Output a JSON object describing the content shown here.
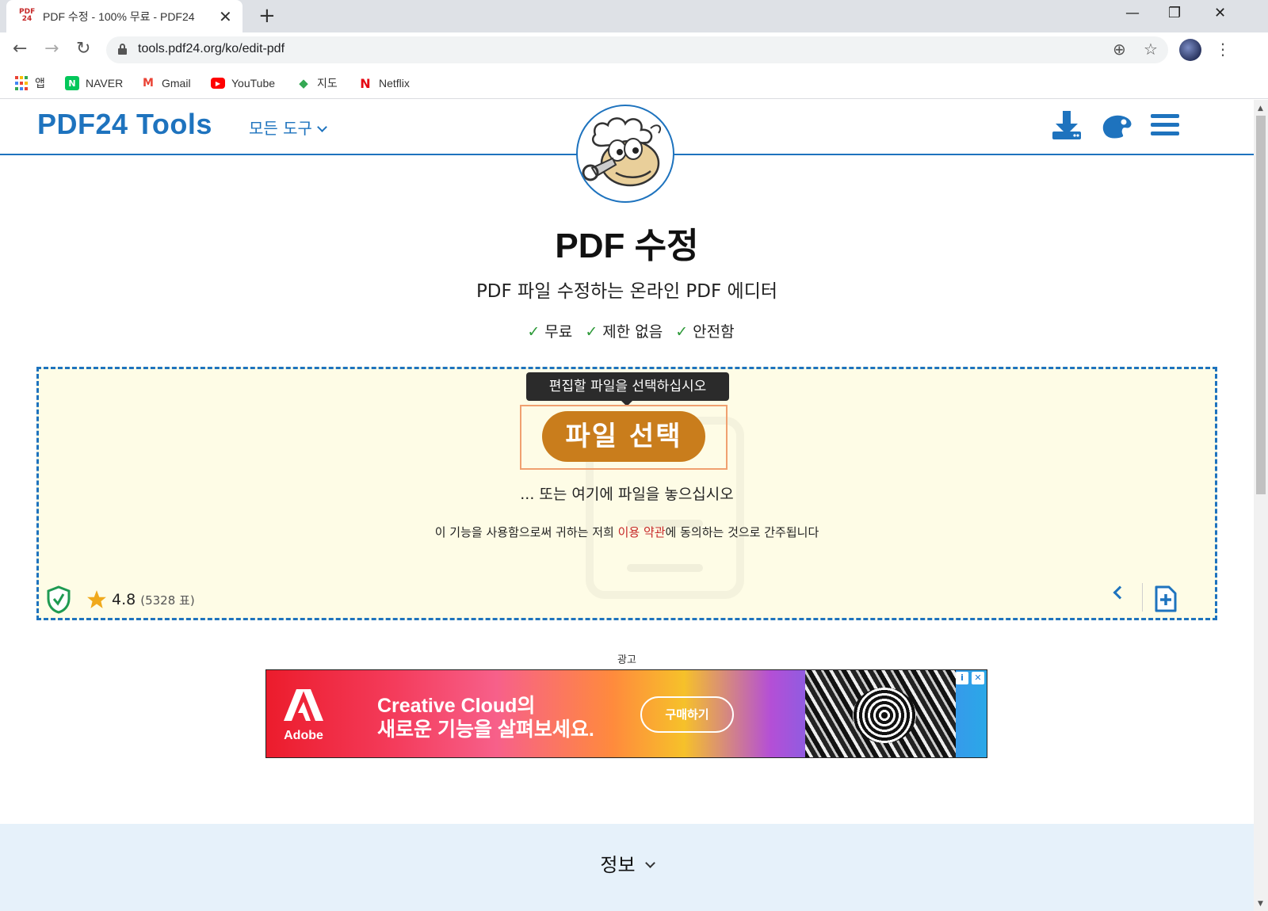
{
  "browser": {
    "tab": {
      "favicon_text_top": "PDF",
      "favicon_text_bottom": "24",
      "title": "PDF 수정 - 100% 무료 - PDF24",
      "close": "✕"
    },
    "new_tab": "+",
    "window_buttons": {
      "minimize": "—",
      "maximize": "❐",
      "close": "✕"
    },
    "url": "tools.pdf24.org/ko/edit-pdf",
    "bookmarks": [
      {
        "label": "앱",
        "icon": "apps-grid-icon"
      },
      {
        "label": "NAVER",
        "icon": "naver-icon",
        "glyph": "N",
        "color": "#03c75a"
      },
      {
        "label": "Gmail",
        "icon": "gmail-icon",
        "glyph": "M",
        "color": "#ea4335"
      },
      {
        "label": "YouTube",
        "icon": "youtube-icon",
        "glyph": "▶",
        "color": "#ff0000"
      },
      {
        "label": "지도",
        "icon": "maps-icon",
        "glyph": "◆",
        "color": "#34a853"
      },
      {
        "label": "Netflix",
        "icon": "netflix-icon",
        "glyph": "N",
        "color": "#e50914"
      }
    ]
  },
  "site": {
    "logo": "PDF24 Tools",
    "all_tools": "모든 도구",
    "accent": "#1e73be"
  },
  "main": {
    "title": "PDF 수정",
    "subtitle": "PDF 파일 수정하는 온라인 PDF 에디터",
    "features": [
      "무료",
      "제한 없음",
      "안전함"
    ],
    "check": "✓"
  },
  "dropzone": {
    "tooltip": "편집할 파일을 선택하십시오",
    "button": "파일 선택",
    "drop_text": "... 또는 여기에 파일을 놓으십시오",
    "terms_before": "이 기능을 사용함으로써 귀하는 저희 ",
    "terms_link": "이용 약관",
    "terms_after": "에 동의하는 것으로 간주됩니다",
    "rating": "4.8",
    "votes": "(5328 표)",
    "button_color": "#c97d1c"
  },
  "ad": {
    "label": "광고",
    "brand": "Adobe",
    "title_line1": "Creative Cloud의",
    "title_line2": "새로운 기능을 살펴보세요.",
    "cta": "구매하기",
    "choices_info": "i",
    "choices_close": "✕"
  },
  "info": {
    "title": "정보"
  }
}
